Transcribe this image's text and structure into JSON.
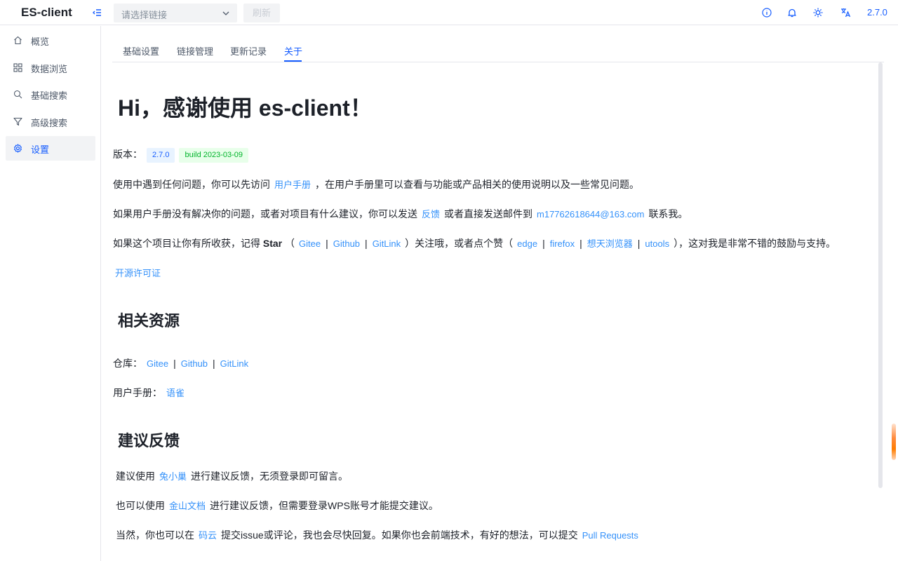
{
  "app": {
    "logo": "ES-client",
    "version": "2.7.0"
  },
  "header": {
    "link_select_placeholder": "请选择链接",
    "refresh_label": "刷新"
  },
  "sidebar": {
    "items": [
      {
        "label": "概览",
        "icon": "home-icon"
      },
      {
        "label": "数据浏览",
        "icon": "grid-icon"
      },
      {
        "label": "基础搜索",
        "icon": "search-icon"
      },
      {
        "label": "高级搜索",
        "icon": "filter-icon"
      },
      {
        "label": "设置",
        "icon": "gear-icon",
        "active": true
      }
    ]
  },
  "tabs": [
    {
      "label": "基础设置"
    },
    {
      "label": "链接管理"
    },
    {
      "label": "更新记录"
    },
    {
      "label": "关于",
      "active": true
    }
  ],
  "about": {
    "title": "Hi，感谢使用 es-client！",
    "version_label": "版本：",
    "version_tag": "2.7.0",
    "build_tag": "build 2023-03-09",
    "p1_a": "使用中遇到任何问题，你可以先访问",
    "p1_link": "用户手册",
    "p1_b": "，在用户手册里可以查看与功能或产品相关的使用说明以及一些常见问题。",
    "p2_a": "如果用户手册没有解决你的问题，或者对项目有什么建议，你可以发送",
    "p2_link1": "反馈",
    "p2_b": "或者直接发送邮件到",
    "p2_email": "m17762618644@163.com",
    "p2_c": "联系我。",
    "p3_a": "如果这个项目让你有所收获，记得",
    "p3_star": "Star",
    "p3_open": "（",
    "p3_gitee": "Gitee",
    "p3_github": "Github",
    "p3_gitlink": "GitLink",
    "p3_close": "）",
    "p3_b": "关注哦，或者点个赞（",
    "p3_edge": "edge",
    "p3_firefox": "firefox",
    "p3_xiangtian": "想天浏览器",
    "p3_utools": "utools",
    "p3_c": "），这对我是非常不错的鼓励与支持。",
    "sep": "|",
    "license_link": "开源许可证",
    "resources_title": "相关资源",
    "repo_label": "仓库：",
    "repo_gitee": "Gitee",
    "repo_github": "Github",
    "repo_gitlink": "GitLink",
    "manual_label": "用户手册：",
    "manual_link": "语雀",
    "feedback_title": "建议反馈",
    "f1_a": "建议使用",
    "f1_link": "兔小巢",
    "f1_b": "进行建议反馈，无须登录即可留言。",
    "f2_a": "也可以使用",
    "f2_link": "金山文档",
    "f2_b": "进行建议反馈，但需要登录WPS账号才能提交建议。",
    "f3_a": "当然，你也可以在",
    "f3_link": "码云",
    "f3_b": "提交issue或评论，我也会尽快回复。如果你也会前端技术，有好的想法，可以提交",
    "f3_pr": "Pull Requests"
  },
  "colors": {
    "primary": "#165dff",
    "link": "#3491fa",
    "success": "#00b42a",
    "accent": "#ff7d00"
  }
}
